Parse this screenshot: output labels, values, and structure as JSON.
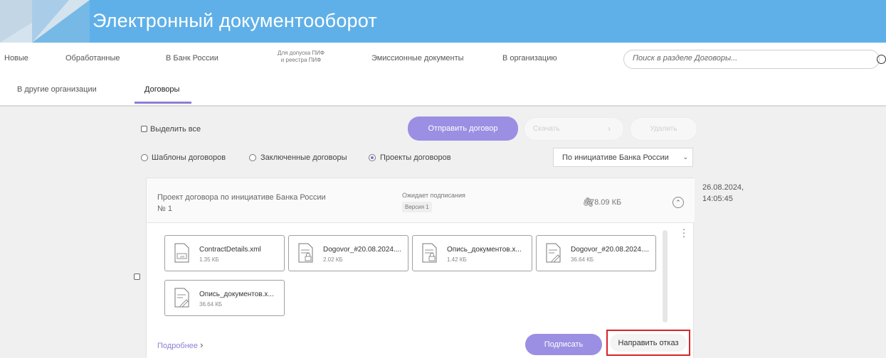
{
  "app": {
    "title": "Электронный документооборот"
  },
  "nav": {
    "row1": [
      "Новые",
      "Обработанные",
      "В Банк России",
      "Эмиссионные документы",
      "В организацию"
    ],
    "pif_line1": "Для допуска ПИФ",
    "pif_line2": "и реестра ПИФ",
    "row2": [
      "В другие организации",
      "Договоры"
    ],
    "active": "Договоры"
  },
  "search": {
    "placeholder": "Поиск в разделе Договоры..."
  },
  "toolbar": {
    "select_all": "Выделить все",
    "send_contract": "Отправить договор",
    "download": "Скачать",
    "delete": "Удалить"
  },
  "filters": {
    "radios": [
      "Шаблоны договоров",
      "Заключенные договоры",
      "Проекты договоров"
    ],
    "selected": "Проекты договоров",
    "dropdown_value": "По инициативе Банка России"
  },
  "card": {
    "title": "Проект договора по инициативе Банка России",
    "number": "№ 1",
    "status": "Ожидает подписания",
    "version": "Версия 1",
    "total_size": "78.09 КБ",
    "date": "26.08.2024,",
    "time": "14:05:45",
    "files": [
      {
        "name": "ContractDetails.xml",
        "size": "1.35 КБ",
        "icon": "xml-file-icon"
      },
      {
        "name": "Dogovor_#20.08.2024....",
        "size": "2.02 КБ",
        "icon": "locked-document-icon"
      },
      {
        "name": "Опись_документов.х...",
        "size": "1.42 КБ",
        "icon": "locked-document-icon"
      },
      {
        "name": "Dogovor_#20.08.2024....",
        "size": "36.64 КБ",
        "icon": "signed-document-icon"
      },
      {
        "name": "Опись_документов.х...",
        "size": "36.64 КБ",
        "icon": "signed-document-icon"
      }
    ],
    "more_link": "Подробнее",
    "sign": "Подписать",
    "refuse": "Направить отказ"
  },
  "colors": {
    "banner": "#5fb0e8",
    "accent": "#9b8fe3",
    "highlight": "#d9222a"
  }
}
